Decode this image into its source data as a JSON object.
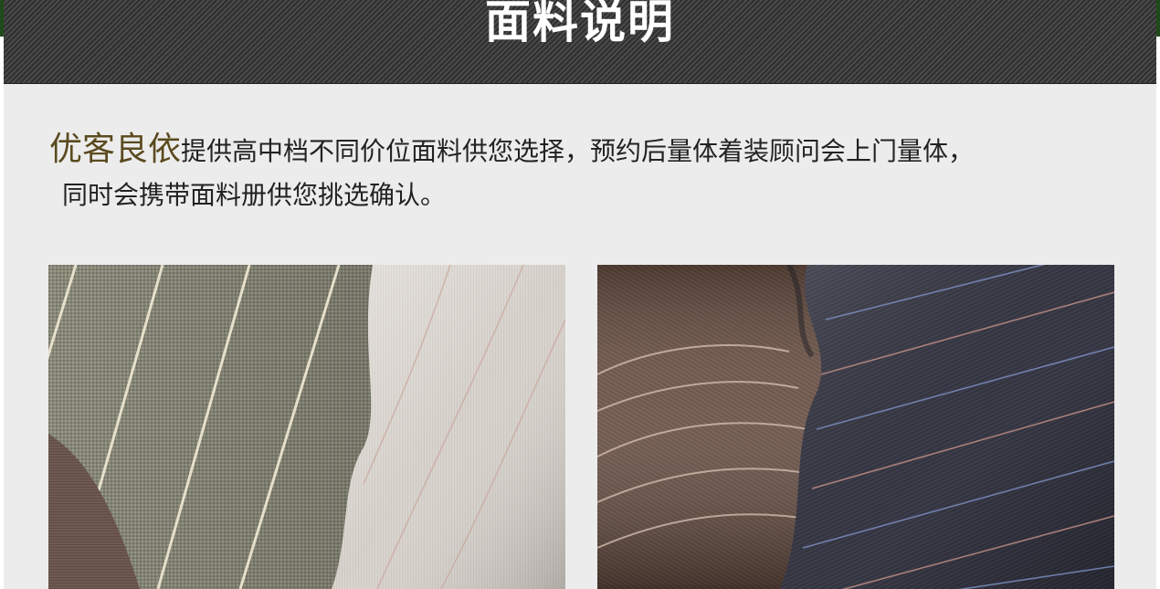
{
  "header": {
    "title": "面料说明"
  },
  "intro": {
    "brand": "优客良依",
    "line1_rest": "提供高中档不同价位面料供您选择，预约后量体着装顾问会上门量体，",
    "line2": "同时会携带面料册供您挑选确认。"
  },
  "colors": {
    "banner_bg": "#3a3a3a",
    "content_bg": "#ececec",
    "brand_text": "#5a4a1e",
    "body_text": "#222222",
    "edge_green": "#1f4a1c"
  },
  "images": [
    {
      "name": "light-pinstripe-fabric-photo"
    },
    {
      "name": "dark-pinstripe-fabric-photo"
    }
  ]
}
